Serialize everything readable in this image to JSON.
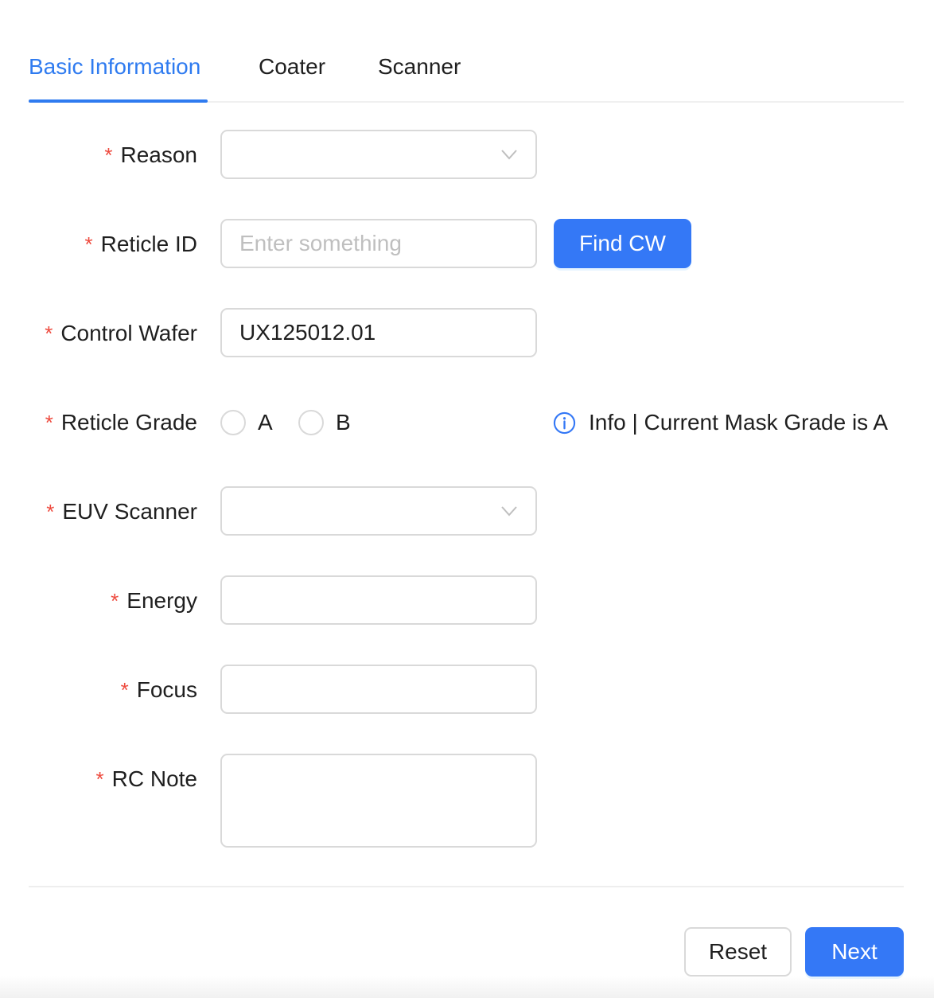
{
  "tabs": [
    {
      "label": "Basic Information",
      "active": true
    },
    {
      "label": "Coater",
      "active": false
    },
    {
      "label": "Scanner",
      "active": false
    }
  ],
  "required_mark": "*",
  "form": {
    "reason": {
      "label": "Reason",
      "value": ""
    },
    "reticle_id": {
      "label": "Reticle ID",
      "value": "",
      "placeholder": "Enter something",
      "button_label": "Find CW"
    },
    "control_wafer": {
      "label": "Control Wafer",
      "value": "UX125012.01"
    },
    "reticle_grade": {
      "label": "Reticle Grade",
      "options": [
        "A",
        "B"
      ],
      "selected": null,
      "info_text": "Info | Current Mask Grade is A"
    },
    "euv_scanner": {
      "label": "EUV Scanner",
      "value": ""
    },
    "energy": {
      "label": "Energy",
      "value": ""
    },
    "focus": {
      "label": "Focus",
      "value": ""
    },
    "rc_note": {
      "label": "RC Note",
      "value": ""
    }
  },
  "footer": {
    "reset_label": "Reset",
    "next_label": "Next"
  },
  "colors": {
    "primary": "#3478f6",
    "required": "#ee4b3f",
    "border": "#d9d9d9",
    "placeholder": "#bfbfbf"
  },
  "icons": {
    "select_arrow": "chevron-down-icon",
    "info": "info-circle-icon"
  }
}
